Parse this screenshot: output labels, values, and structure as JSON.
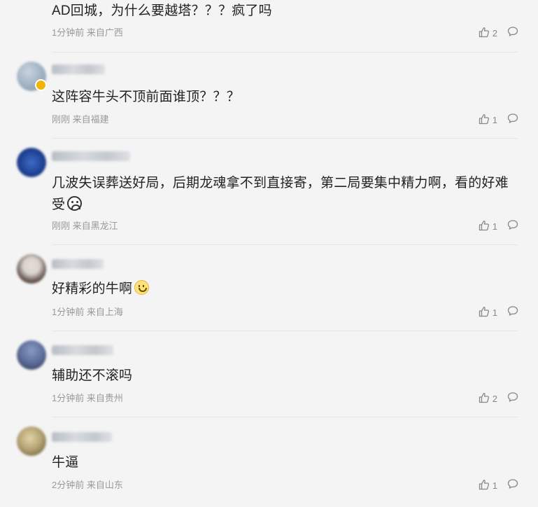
{
  "comments": [
    {
      "text": "AD回城，为什么要越塔？？？疯了吗",
      "time": "1分钟前",
      "location": "来自广西",
      "likes": "2",
      "avatar_colors": []
    },
    {
      "text": "这阵容牛头不顶前面谁顶？？？",
      "time": "刚刚",
      "location": "来自福建",
      "likes": "1",
      "avatar_colors": [
        "#9fb0c2",
        "#7e8f9d"
      ]
    },
    {
      "text": "几波失误葬送好局，后期龙魂拿不到直接寄，第二局要集中精力啊，看的好难受",
      "time": "刚刚",
      "location": "来自黑龙江",
      "likes": "1",
      "avatar_colors": [
        "#1e3f8f",
        "#3d6bc7"
      ]
    },
    {
      "text": "好精彩的牛啊",
      "time": "1分钟前",
      "location": "来自上海",
      "likes": "1",
      "avatar_colors": [
        "#d9d4cf",
        "#3a2f2b"
      ]
    },
    {
      "text": "辅助还不滚吗",
      "time": "1分钟前",
      "location": "来自贵州",
      "likes": "2",
      "avatar_colors": [
        "#5d6e9a",
        "#2c3552"
      ]
    },
    {
      "text": "牛逼",
      "time": "2分钟前",
      "location": "来自山东",
      "likes": "1",
      "avatar_colors": [
        "#b8a677",
        "#5b4e2c"
      ]
    }
  ],
  "icons": {
    "like": "thumbs-up-icon",
    "reply": "speech-bubble-icon"
  }
}
